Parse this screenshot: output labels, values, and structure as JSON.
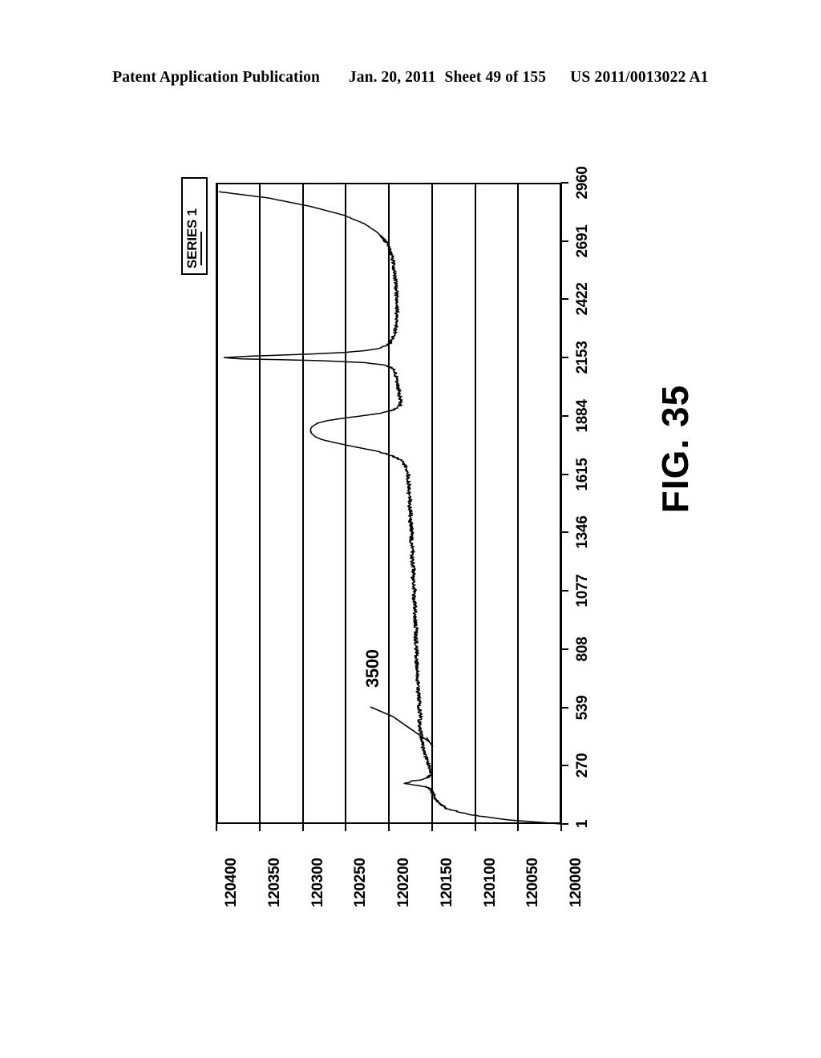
{
  "header": {
    "publication": "Patent Application Publication",
    "date": "Jan. 20, 2011",
    "sheet": "Sheet 49 of 155",
    "patent_number": "US 2011/0013022 A1"
  },
  "figure": {
    "caption": "FIG. 35"
  },
  "callout": {
    "label": "3500"
  },
  "legend": {
    "entries": [
      "SERIES 1"
    ],
    "position": "top-left-outside",
    "label": "SERIES 1"
  },
  "colors": {
    "ink": "#000000",
    "paper": "#ffffff",
    "series_1": "#000000"
  },
  "chart_data": {
    "type": "line",
    "title": "",
    "subtitle": "",
    "xlabel": "",
    "ylabel": "",
    "orientation": "rotated-90-ccw",
    "grid": true,
    "legend_position": "outside-top-left",
    "xlim": [
      1,
      2960
    ],
    "ylim": [
      120000,
      120400
    ],
    "x_tick_labels": [
      "1",
      "270",
      "539",
      "808",
      "1077",
      "1346",
      "1615",
      "1884",
      "2153",
      "2422",
      "2691",
      "2960"
    ],
    "x_ticks": [
      1,
      270,
      539,
      808,
      1077,
      1346,
      1615,
      1884,
      2153,
      2422,
      2691,
      2960
    ],
    "y_tick_labels": [
      "120400",
      "120350",
      "120300",
      "120250",
      "120200",
      "120150",
      "120100",
      "120050",
      "120000"
    ],
    "y_ticks": [
      120400,
      120350,
      120300,
      120250,
      120200,
      120150,
      120100,
      120050,
      120000
    ],
    "series": [
      {
        "name": "SERIES 1",
        "color": "#000000",
        "x": [
          1,
          20,
          45,
          70,
          95,
          120,
          145,
          160,
          172,
          180,
          188,
          196,
          205,
          215,
          228,
          240,
          255,
          270,
          290,
          310,
          330,
          350,
          375,
          400,
          420,
          440,
          460,
          480,
          500,
          520,
          539,
          560,
          585,
          610,
          640,
          670,
          700,
          730,
          760,
          790,
          808,
          840,
          870,
          900,
          930,
          960,
          990,
          1020,
          1050,
          1077,
          1110,
          1140,
          1170,
          1200,
          1230,
          1260,
          1290,
          1320,
          1346,
          1380,
          1410,
          1440,
          1470,
          1500,
          1530,
          1560,
          1590,
          1615,
          1650,
          1680,
          1700,
          1720,
          1740,
          1760,
          1775,
          1790,
          1805,
          1820,
          1835,
          1850,
          1862,
          1872,
          1884,
          1896,
          1908,
          1920,
          1932,
          1945,
          1958,
          1970,
          1985,
          2000,
          2015,
          2030,
          2045,
          2060,
          2075,
          2090,
          2105,
          2118,
          2130,
          2140,
          2147,
          2153,
          2160,
          2168,
          2176,
          2185,
          2195,
          2208,
          2222,
          2240,
          2260,
          2285,
          2310,
          2340,
          2370,
          2400,
          2422,
          2460,
          2500,
          2540,
          2580,
          2620,
          2660,
          2691,
          2730,
          2770,
          2810,
          2850,
          2890,
          2920,
          2940,
          2955,
          2960
        ],
        "y": [
          120000,
          120062,
          120108,
          120132,
          120141,
          120146,
          120149,
          120151,
          120156,
          120168,
          120182,
          120176,
          120163,
          120155,
          120152,
          120151,
          120152,
          120153,
          120155,
          120157,
          120158,
          120160,
          120161,
          120162,
          120163,
          120163,
          120164,
          120164,
          120163,
          120164,
          120165,
          120164,
          120165,
          120166,
          120166,
          120167,
          120166,
          120167,
          120168,
          120167,
          120168,
          120168,
          120169,
          120168,
          120169,
          120170,
          120169,
          120170,
          120171,
          120170,
          120171,
          120172,
          120171,
          120172,
          120173,
          120172,
          120173,
          120174,
          120173,
          120174,
          120175,
          120174,
          120176,
          120175,
          120177,
          120176,
          120178,
          120177,
          120180,
          120186,
          120196,
          120212,
          120238,
          120262,
          120278,
          120286,
          120290,
          120291,
          120289,
          120283,
          120272,
          120255,
          120232,
          120210,
          120196,
          120190,
          120187,
          120186,
          120186,
          120187,
          120188,
          120188,
          120189,
          120190,
          120190,
          120191,
          120192,
          120193,
          120196,
          120204,
          120228,
          120286,
          120370,
          120392,
          120360,
          120300,
          120255,
          120228,
          120212,
          120203,
          120198,
          120195,
          120193,
          120192,
          120191,
          120191,
          120190,
          120190,
          120191,
          120191,
          120192,
          120193,
          120194,
          120196,
          120199,
          120204,
          120213,
          120228,
          120252,
          120290,
          120340,
          120400
        ],
        "noise_amplitude": 2.0,
        "baseline": 120150
      }
    ],
    "annotations": [
      {
        "text": "3500",
        "points_to_x": 300,
        "points_to_y": 120175
      }
    ]
  }
}
